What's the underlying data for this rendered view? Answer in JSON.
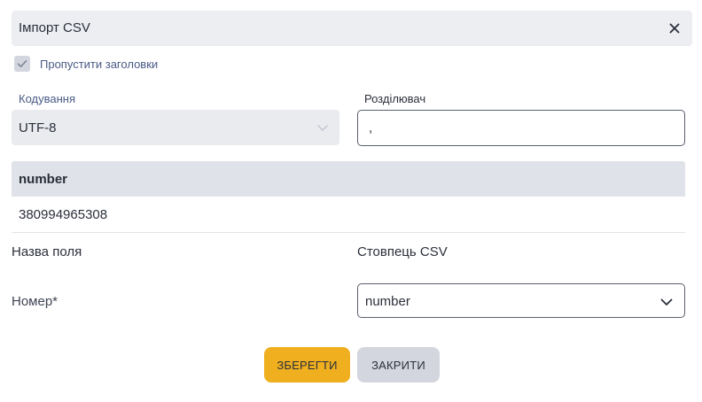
{
  "dialog": {
    "title": "Імпорт CSV",
    "close_icon": "close-icon"
  },
  "skip_headers": {
    "label": "Пропустити заголовки",
    "checked": true
  },
  "encoding": {
    "label": "Кодування",
    "value": "UTF-8",
    "disabled": true
  },
  "separator": {
    "label": "Розділювач",
    "value": ","
  },
  "preview": {
    "header": "number",
    "rows": [
      "380994965308"
    ]
  },
  "mapping": {
    "field_header": "Назва поля",
    "csv_header": "Стовпець CSV",
    "fields": [
      {
        "name": "Номер*",
        "column": "number"
      }
    ]
  },
  "buttons": {
    "save": "ЗБЕРЕГТИ",
    "close": "ЗАКРИТИ"
  },
  "colors": {
    "accent": "#efaf1f",
    "secondary_button": "#d3d6df",
    "header_bg": "#eceef2"
  }
}
